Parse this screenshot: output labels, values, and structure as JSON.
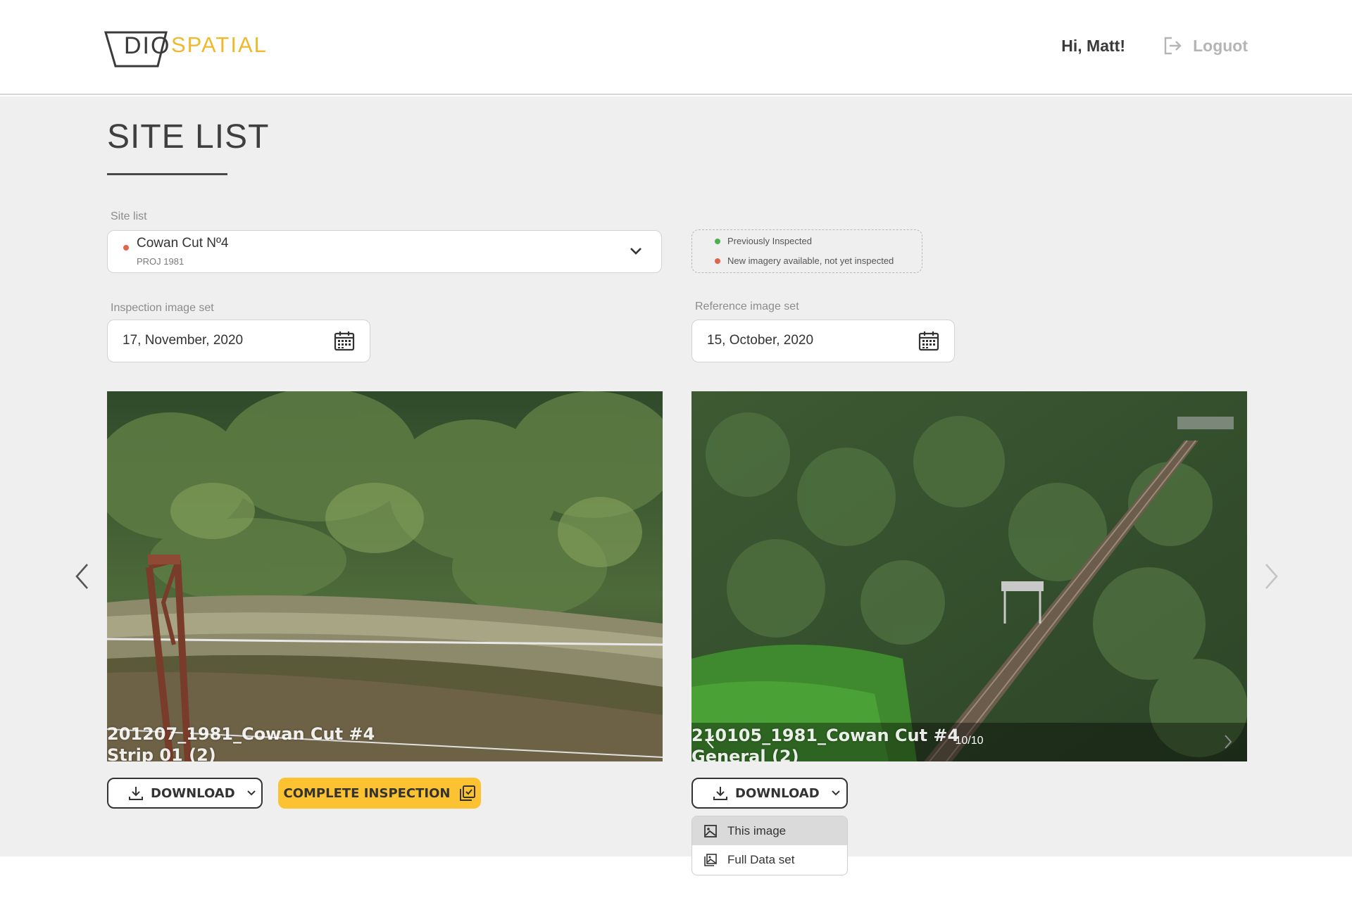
{
  "header": {
    "logo_dio": "DIO",
    "logo_spatial": "SPATIAL",
    "greeting": "Hi, Matt!",
    "logout_label": "Loguot"
  },
  "page": {
    "title": "SITE LIST"
  },
  "site_select": {
    "label": "Site list",
    "name": "Cowan Cut Nº4",
    "code": "PROJ 1981",
    "status_color": "#e0654a"
  },
  "legend": {
    "items": [
      {
        "label": "Previously Inspected",
        "color": "#4cb050"
      },
      {
        "label": "New imagery available, not yet inspected",
        "color": "#e0654a"
      }
    ]
  },
  "inspection": {
    "label": "Inspection image set",
    "date": "17, November, 2020",
    "caption_line1": "201207_1981_Cowan Cut #4",
    "caption_line2": "Strip 01 (2)",
    "download_label": "DOWNLOAD",
    "complete_label": "COMPLETE INSPECTION"
  },
  "reference": {
    "label": "Reference image set",
    "date": "15, October, 2020",
    "caption_line1": "210105_1981_Cowan Cut #4",
    "caption_line2": "General (2)",
    "counter": "10/10",
    "download_label": "DOWNLOAD",
    "menu": [
      {
        "label": "This image"
      },
      {
        "label": "Full Data set"
      }
    ]
  },
  "colors": {
    "accent": "#fcc232",
    "logo_yellow": "#f0b92c",
    "background": "#efefef"
  }
}
